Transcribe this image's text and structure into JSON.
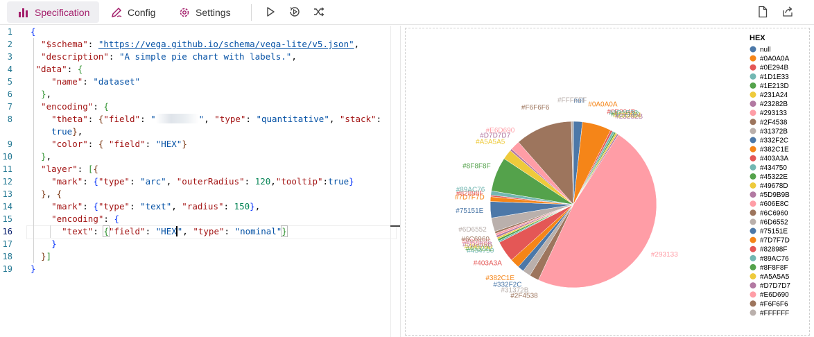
{
  "toolbar": {
    "tabs": [
      {
        "label": "Specification",
        "icon": "bar-chart-icon",
        "active": true
      },
      {
        "label": "Config",
        "icon": "pen-icon",
        "active": false
      },
      {
        "label": "Settings",
        "icon": "gear-icon",
        "active": false
      }
    ],
    "actions": [
      "run-icon",
      "auto-run-icon",
      "shuffle-icon"
    ],
    "right_actions": [
      "new-file-icon",
      "share-icon"
    ],
    "accent_color": "#a31d6a"
  },
  "editor": {
    "line_numbers": [
      "1",
      "2",
      "3",
      "4",
      "5",
      "6",
      "7",
      "8",
      "",
      "9",
      "10",
      "11",
      "12",
      "13",
      "14",
      "15",
      "16",
      "17",
      "18",
      "19"
    ],
    "current_line": "16",
    "lines": [
      "{",
      "  \"$schema\": \"https://vega.github.io/schema/vega-lite/v5.json\",",
      "  \"description\": \"A simple pie chart with labels.\",",
      " \"data\": {",
      "    \"name\": \"dataset\"",
      "  },",
      "  \"encoding\": {",
      "    \"theta\": {\"field\": \"[redacted]\", \"type\": \"quantitative\", \"stack\":",
      "    true},",
      "    \"color\": { \"field\": \"HEX\"}",
      "  },",
      "  \"layer\": [{",
      "    \"mark\": {\"type\": \"arc\", \"outerRadius\": 120,\"tooltip\":true}",
      "  }, {",
      "    \"mark\": {\"type\": \"text\", \"radius\": 150},",
      "    \"encoding\": {",
      "      \"text\": {\"field\": \"HEX\", \"type\": \"nominal\"}",
      "    }",
      "  }]",
      "}"
    ]
  },
  "chart_data": {
    "type": "pie",
    "legend_title": "HEX",
    "legend_position": "right",
    "categories": [
      "null",
      "#0A0A0A",
      "#0E294B",
      "#1D1E33",
      "#1E213D",
      "#231A24",
      "#23282B",
      "#293133",
      "#2F4538",
      "#31372B",
      "#332F2C",
      "#382C1E",
      "#403A3A",
      "#434750",
      "#45322E",
      "#49678D",
      "#5D9B9B",
      "#606E8C",
      "#6C6960",
      "#6D6552",
      "#75151E",
      "#7D7F7D",
      "#82898F",
      "#89AC76",
      "#8F8F8F",
      "#A5A5A5",
      "#D7D7D7",
      "#E6D690",
      "#F6F6F6",
      "#FFFFFF"
    ],
    "colors": [
      "#4c78a8",
      "#f58518",
      "#e45756",
      "#72b7b2",
      "#54a24b",
      "#eeca3b",
      "#b279a2",
      "#ff9da6",
      "#9d755d",
      "#bab0ac",
      "#4c78a8",
      "#f58518",
      "#e45756",
      "#72b7b2",
      "#54a24b",
      "#eeca3b",
      "#b279a2",
      "#ff9da6",
      "#9d755d",
      "#bab0ac",
      "#4c78a8",
      "#f58518",
      "#e45756",
      "#72b7b2",
      "#54a24b",
      "#eeca3b",
      "#b279a2",
      "#ff9da6",
      "#9d755d",
      "#bab0ac"
    ],
    "values": [
      1.7,
      5.5,
      0.4,
      0.4,
      0.3,
      0.3,
      0.3,
      46.6,
      1.8,
      1.5,
      1.2,
      1.8,
      4.0,
      0.3,
      0.4,
      0.3,
      0.4,
      0.4,
      0.4,
      2.6,
      3.1,
      0.9,
      0.3,
      0.8,
      6.5,
      1.9,
      0.4,
      1.8,
      10.8,
      0.4
    ]
  }
}
